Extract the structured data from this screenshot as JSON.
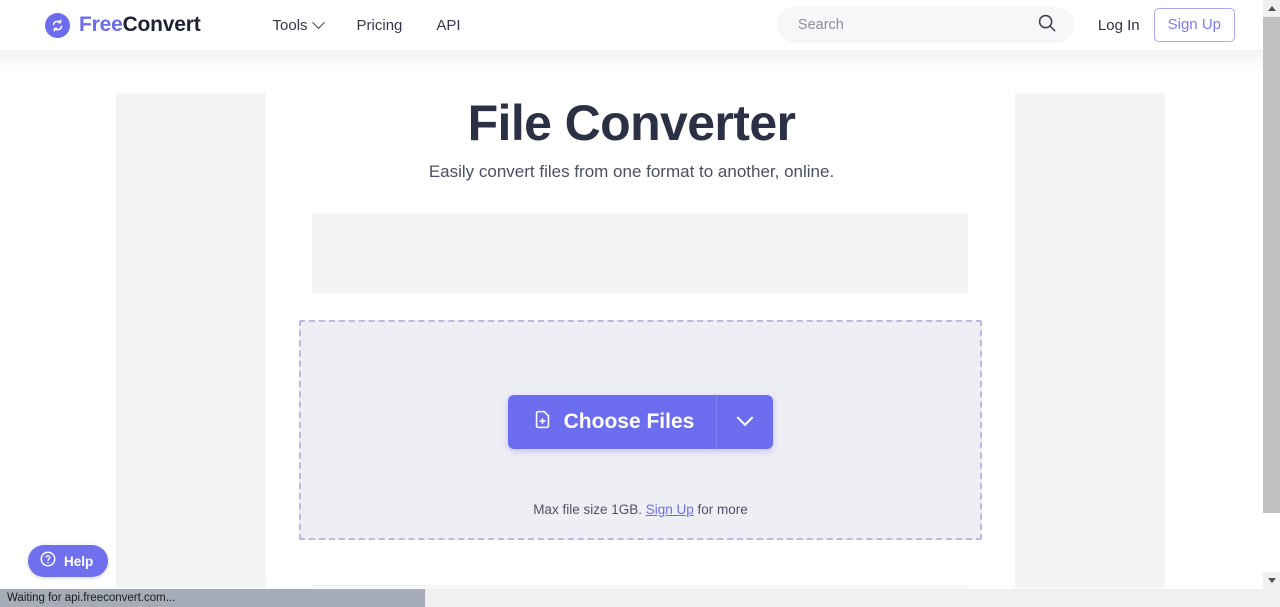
{
  "header": {
    "brand": {
      "prefix": "Free",
      "suffix": "Convert",
      "icon": "sync-circle-icon"
    },
    "nav": [
      {
        "label": "Tools",
        "has_caret": true,
        "icon": "chevron-down-icon"
      },
      {
        "label": "Pricing",
        "has_caret": false
      },
      {
        "label": "API",
        "has_caret": false
      }
    ],
    "search": {
      "placeholder": "Search",
      "value": "",
      "icon": "search-icon"
    },
    "login_label": "Log In",
    "signup_label": "Sign Up"
  },
  "main": {
    "title": "File Converter",
    "subtitle": "Easily convert files from one format to another, online.",
    "dropzone": {
      "choose_files_label": "Choose Files",
      "choose_files_icon": "file-plus-icon",
      "more_options_icon": "chevron-down-icon",
      "note_prefix": "Max file size 1GB.",
      "note_link": "Sign Up",
      "note_suffix": "for more"
    }
  },
  "help_widget": {
    "label": "Help",
    "icon": "question-circle-icon"
  },
  "browser": {
    "status_text": "Waiting for api.freeconvert.com...",
    "scroll_up_icon": "triangle-up-icon",
    "scroll_down_icon": "triangle-down-icon"
  },
  "colors": {
    "brand_purple": "#6c6ced",
    "button_purple": "#6c6cee",
    "dropzone_fill": "#eeeef5",
    "dropzone_border": "#b9b9e2",
    "title_navy": "#2b3044",
    "ad_placeholder": "#f4f4f5",
    "search_bg": "#f7f7f9"
  }
}
